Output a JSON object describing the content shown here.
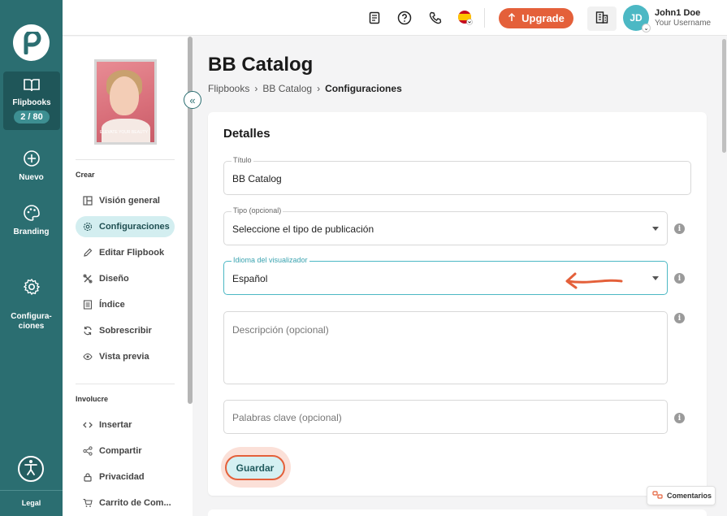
{
  "rail": {
    "items": [
      {
        "label": "Flipbooks",
        "badge": "2 / 80"
      },
      {
        "label": "Nuevo"
      },
      {
        "label": "Branding"
      },
      {
        "label": "Configura-\nciones"
      }
    ],
    "legal": "Legal"
  },
  "topbar": {
    "upgrade_label": "Upgrade",
    "avatar_initials": "JD",
    "user_name": "John1 Doe",
    "user_sub": "Your Username"
  },
  "sidebar": {
    "thumb_caption": "ELEVATE YOUR BEAUTY",
    "section_create": "Crear",
    "create_items": [
      {
        "label": "Visión general",
        "icon": "layout-icon"
      },
      {
        "label": "Configuraciones",
        "icon": "gear-icon",
        "active": true
      },
      {
        "label": "Editar Flipbook",
        "icon": "pencil-icon"
      },
      {
        "label": "Diseño",
        "icon": "tools-icon"
      },
      {
        "label": "Índice",
        "icon": "list-icon"
      },
      {
        "label": "Sobrescribir",
        "icon": "refresh-icon"
      },
      {
        "label": "Vista previa",
        "icon": "eye-icon"
      }
    ],
    "section_engage": "Involucre",
    "engage_items": [
      {
        "label": "Insertar",
        "icon": "code-icon"
      },
      {
        "label": "Compartir",
        "icon": "share-icon"
      },
      {
        "label": "Privacidad",
        "icon": "lock-icon"
      },
      {
        "label": "Carrito de Com...",
        "icon": "cart-icon"
      }
    ]
  },
  "main": {
    "title": "BB Catalog",
    "breadcrumb": [
      "Flipbooks",
      "BB Catalog",
      "Configuraciones"
    ],
    "card_title": "Detalles",
    "fields": {
      "title": {
        "label": "Título",
        "value": "BB Catalog"
      },
      "type": {
        "label": "Tipo (opcional)",
        "value": "Seleccione el tipo de publicación"
      },
      "language": {
        "label": "Idioma del visualizador",
        "value": "Español"
      },
      "description": {
        "placeholder": "Descripción (opcional)"
      },
      "keywords": {
        "placeholder": "Palabras clave (opcional)"
      }
    },
    "save_label": "Guardar"
  },
  "feedback_label": "Comentarios",
  "colors": {
    "rail": "#2b6e71",
    "accent": "#e4603a",
    "teal": "#4cb8c4"
  }
}
